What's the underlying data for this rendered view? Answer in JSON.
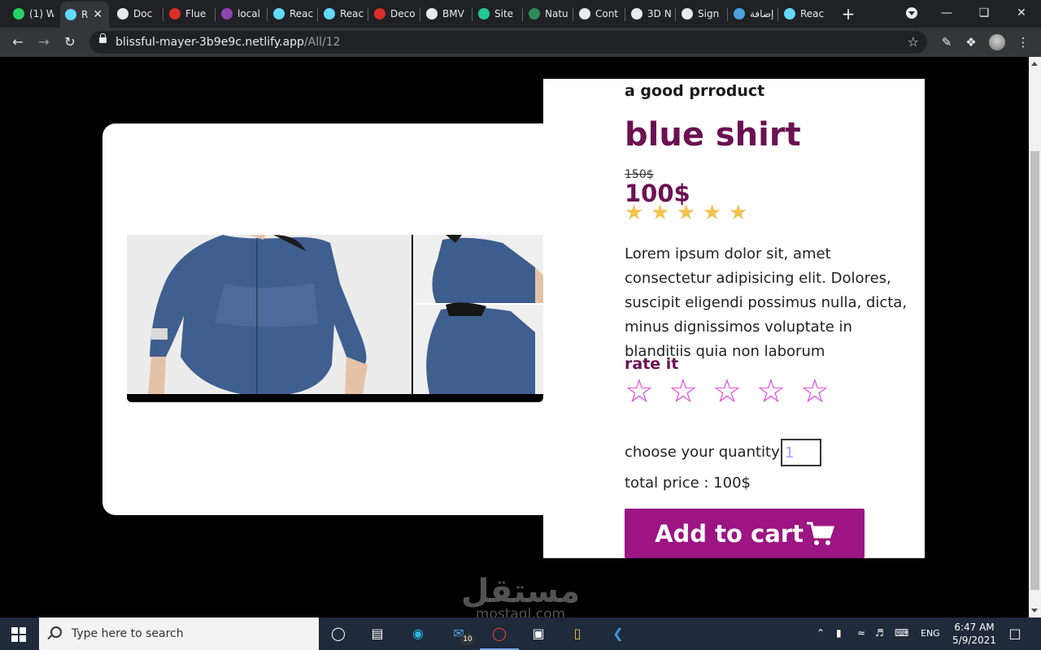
{
  "browser": {
    "tabs": [
      {
        "label": "(1) W",
        "favicon": "whatsapp-icon",
        "color": "#25d366"
      },
      {
        "label": "R",
        "favicon": "react-icon",
        "color": "#61dafb",
        "active": true
      },
      {
        "label": "Doc",
        "favicon": "globe-icon",
        "color": "#e8eaed"
      },
      {
        "label": "Flue",
        "favicon": "ninety-icon",
        "color": "#d93025"
      },
      {
        "label": "local",
        "favicon": "g-icon",
        "color": "#8e44ad"
      },
      {
        "label": "Reac",
        "favicon": "react-icon",
        "color": "#61dafb"
      },
      {
        "label": "Reac",
        "favicon": "react-icon",
        "color": "#61dafb"
      },
      {
        "label": "Deco",
        "favicon": "m-icon",
        "color": "#d93025"
      },
      {
        "label": "BMV",
        "favicon": "globe-icon",
        "color": "#e8eaed"
      },
      {
        "label": "Site",
        "favicon": "diamond-icon",
        "color": "#20c997"
      },
      {
        "label": "Natu",
        "favicon": "w-icon",
        "color": "#2e8b57"
      },
      {
        "label": "Cont",
        "favicon": "globe-icon",
        "color": "#e8eaed"
      },
      {
        "label": "3D N",
        "favicon": "globe-icon",
        "color": "#e8eaed"
      },
      {
        "label": "Sign",
        "favicon": "globe-icon",
        "color": "#e8eaed"
      },
      {
        "label": "إضافة",
        "favicon": "ring-icon",
        "color": "#4aa3df"
      },
      {
        "label": "Reac",
        "favicon": "react-icon",
        "color": "#61dafb"
      }
    ],
    "new_tab": "+",
    "url_host": "blissful-mayer-3b9e9c.netlify.app",
    "url_path": "/All/12"
  },
  "product": {
    "subtitle": "a good prroduct",
    "title": "blue shirt",
    "old_price": "150$",
    "price": "100$",
    "rating": 5,
    "rating_symbol": "★",
    "description": "Lorem ipsum dolor sit, amet consectetur adipisicing elit. Dolores, suscipit eligendi possimus nulla, dicta, minus dignissimos voluptate in blanditiis quia non laborum",
    "rate_label": "rate it",
    "rate_symbol": "☆",
    "quantity_label": "choose your quantity",
    "quantity_value": "1",
    "total_label": "total price : 100$",
    "cart_button": "Add to cart",
    "accent_color": "#9c1582",
    "title_color": "#6b1152"
  },
  "watermark": {
    "arabic": "مستقل",
    "latin": "mostaql.com"
  },
  "taskbar": {
    "search_placeholder": "Type here to search",
    "mail_badge": "10",
    "language": "ENG",
    "time": "6:47 AM",
    "date": "5/9/2021"
  }
}
